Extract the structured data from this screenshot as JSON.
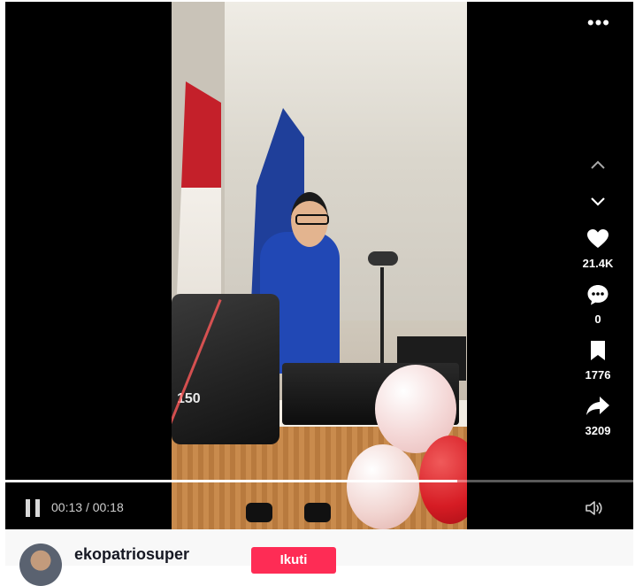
{
  "player": {
    "more_label": "•••",
    "time_current": "00:13",
    "time_separator": "/",
    "time_total": "00:18",
    "progress_fraction": 0.72,
    "speaker_text": "150"
  },
  "actions": {
    "likes": "21.4K",
    "comments": "0",
    "saves": "1776",
    "shares": "3209"
  },
  "user": {
    "username": "ekopatriosuper",
    "follow_label": "Ikuti"
  },
  "colors": {
    "accent": "#fe2c55",
    "icon": "#ffffff",
    "player_bg": "#000000"
  },
  "icons": {
    "more": "more-dots-icon",
    "up": "chevron-up-icon",
    "down": "chevron-down-icon",
    "like": "heart-icon",
    "comment": "comment-icon",
    "save": "bookmark-icon",
    "share": "share-arrow-icon",
    "pause": "pause-icon",
    "volume": "volume-icon"
  }
}
